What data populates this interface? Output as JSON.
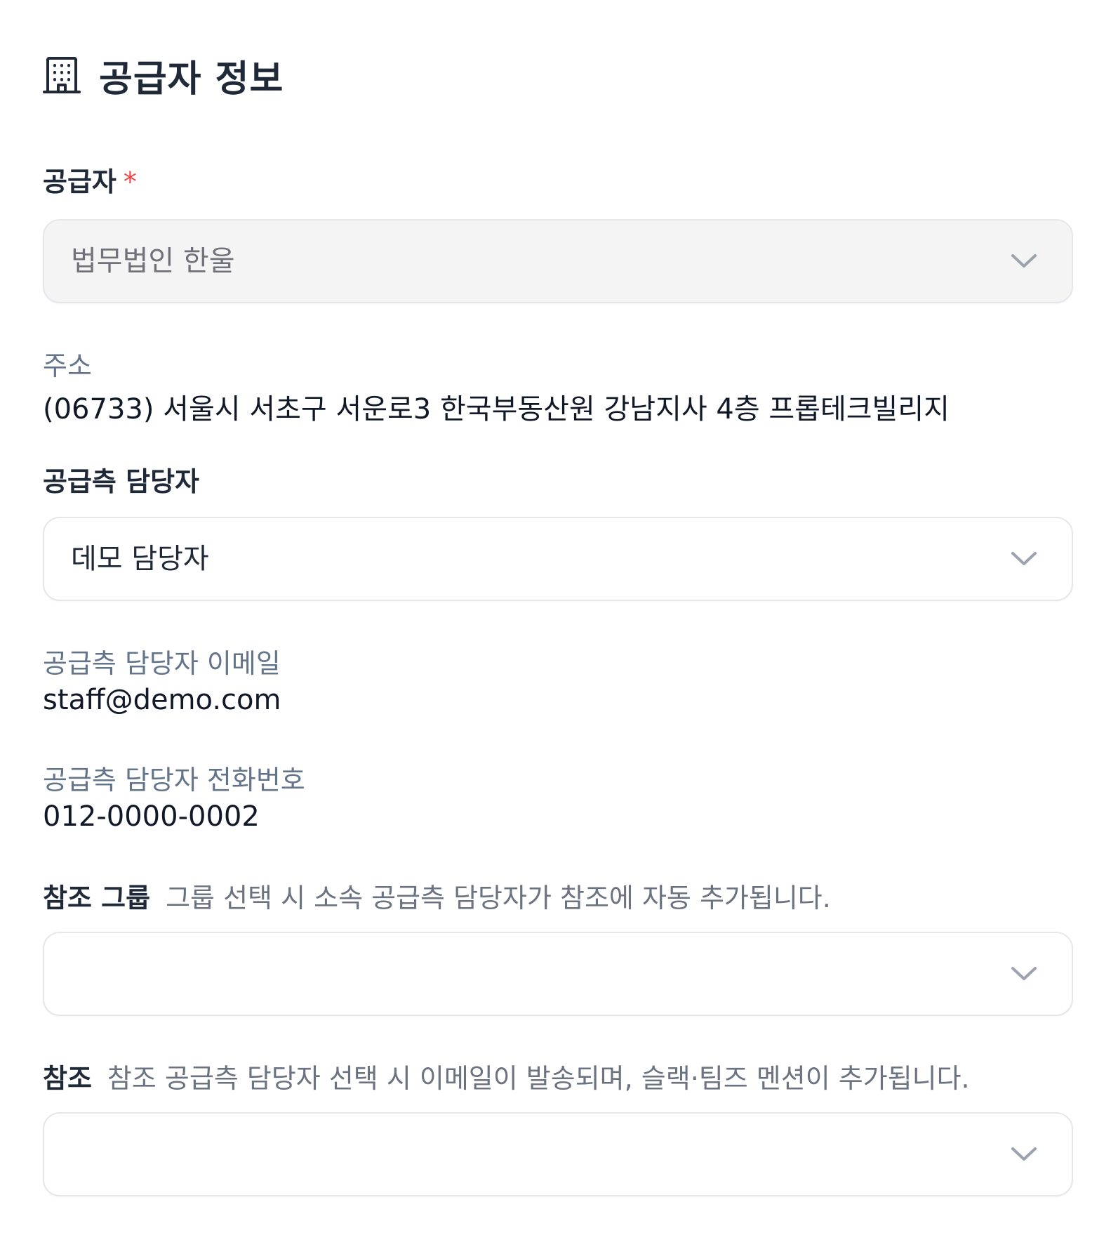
{
  "section": {
    "icon": "building-icon",
    "title": "공급자 정보"
  },
  "supplier": {
    "label": "공급자",
    "required_mark": "*",
    "value": "법무법인 한울",
    "disabled": true,
    "chevron_icon": "chevron-down-icon"
  },
  "address": {
    "label": "주소",
    "value": "(06733) 서울시 서초구 서운로3 한국부동산원 강남지사 4층 프롭테크빌리지"
  },
  "supplier_contact": {
    "label": "공급측 담당자",
    "value": "데모 담당자",
    "chevron_icon": "chevron-down-icon"
  },
  "contact_email": {
    "label": "공급측 담당자 이메일",
    "value": "staff@demo.com"
  },
  "contact_phone": {
    "label": "공급측 담당자 전화번호",
    "value": "012-0000-0002"
  },
  "cc_group": {
    "label": "참조 그룹",
    "hint": "그룹 선택 시 소속 공급측 담당자가 참조에 자동 추가됩니다.",
    "value": "",
    "chevron_icon": "chevron-down-icon"
  },
  "cc": {
    "label": "참조",
    "hint": "참조 공급측 담당자 선택 시 이메일이 발송되며, 슬랙·팀즈 멘션이 추가됩니다.",
    "value": "",
    "chevron_icon": "chevron-down-icon"
  }
}
